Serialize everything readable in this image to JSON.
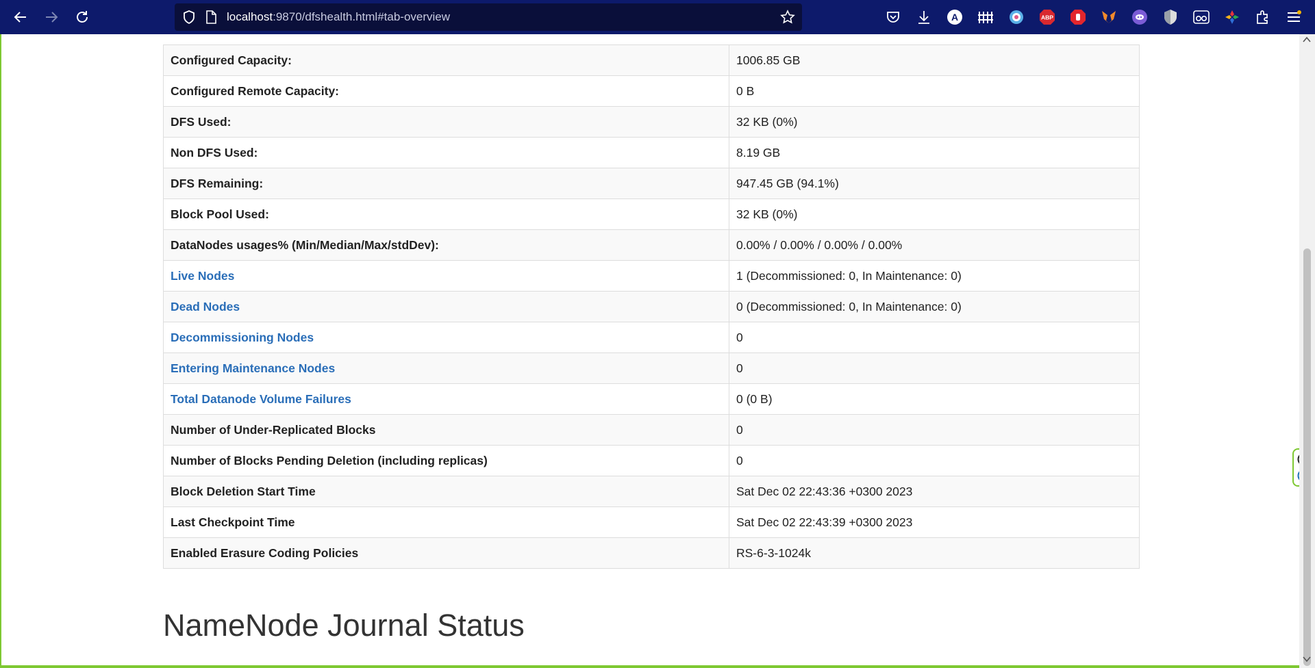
{
  "browser": {
    "url_host": "localhost",
    "url_rest": ":9870/dfshealth.html#tab-overview",
    "icons": {
      "back": "back-arrow-icon",
      "forward": "forward-arrow-icon",
      "reload": "reload-icon",
      "tracking": "shield-icon",
      "page": "page-icon",
      "bookmark": "star-icon"
    },
    "toolbar_icons": [
      "pocket-icon",
      "download-icon",
      "extension-a-icon",
      "extension-grid-icon",
      "extension-circle-icon",
      "adblock-plus-icon",
      "block-hand-icon",
      "metamask-icon",
      "extension-ghost-icon",
      "shield-badge-icon",
      "glasses-icon",
      "puzzle-color-icon",
      "extensions-icon",
      "menu-icon"
    ],
    "adblock_label": "ABP",
    "extension_a_label": "A"
  },
  "overview": {
    "rows": [
      {
        "label": "Configured Capacity:",
        "value": "1006.85 GB",
        "link": false
      },
      {
        "label": "Configured Remote Capacity:",
        "value": "0 B",
        "link": false
      },
      {
        "label": "DFS Used:",
        "value": "32 KB (0%)",
        "link": false
      },
      {
        "label": "Non DFS Used:",
        "value": "8.19 GB",
        "link": false
      },
      {
        "label": "DFS Remaining:",
        "value": "947.45 GB (94.1%)",
        "link": false
      },
      {
        "label": "Block Pool Used:",
        "value": "32 KB (0%)",
        "link": false
      },
      {
        "label": "DataNodes usages% (Min/Median/Max/stdDev):",
        "value": "0.00% / 0.00% / 0.00% / 0.00%",
        "link": false
      },
      {
        "label": "Live Nodes",
        "value": "1 (Decommissioned: 0, In Maintenance: 0)",
        "link": true
      },
      {
        "label": "Dead Nodes",
        "value": "0 (Decommissioned: 0, In Maintenance: 0)",
        "link": true
      },
      {
        "label": "Decommissioning Nodes",
        "value": "0",
        "link": true
      },
      {
        "label": "Entering Maintenance Nodes",
        "value": "0",
        "link": true
      },
      {
        "label": "Total Datanode Volume Failures",
        "value": "0 (0 B)",
        "link": true
      },
      {
        "label": "Number of Under-Replicated Blocks",
        "value": "0",
        "link": false
      },
      {
        "label": "Number of Blocks Pending Deletion (including replicas)",
        "value": "0",
        "link": false
      },
      {
        "label": "Block Deletion Start Time",
        "value": "Sat Dec 02 22:43:36 +0300 2023",
        "link": false
      },
      {
        "label": "Last Checkpoint Time",
        "value": "Sat Dec 02 22:43:39 +0300 2023",
        "link": false
      },
      {
        "label": "Enabled Erasure Coding Policies",
        "value": "RS-6-3-1024k",
        "link": false
      }
    ]
  },
  "journal_heading": "NameNode Journal Status",
  "colors": {
    "toolbar": "#0d1a6b",
    "link": "#2a6eb8",
    "frame_accent": "#7ec832"
  }
}
